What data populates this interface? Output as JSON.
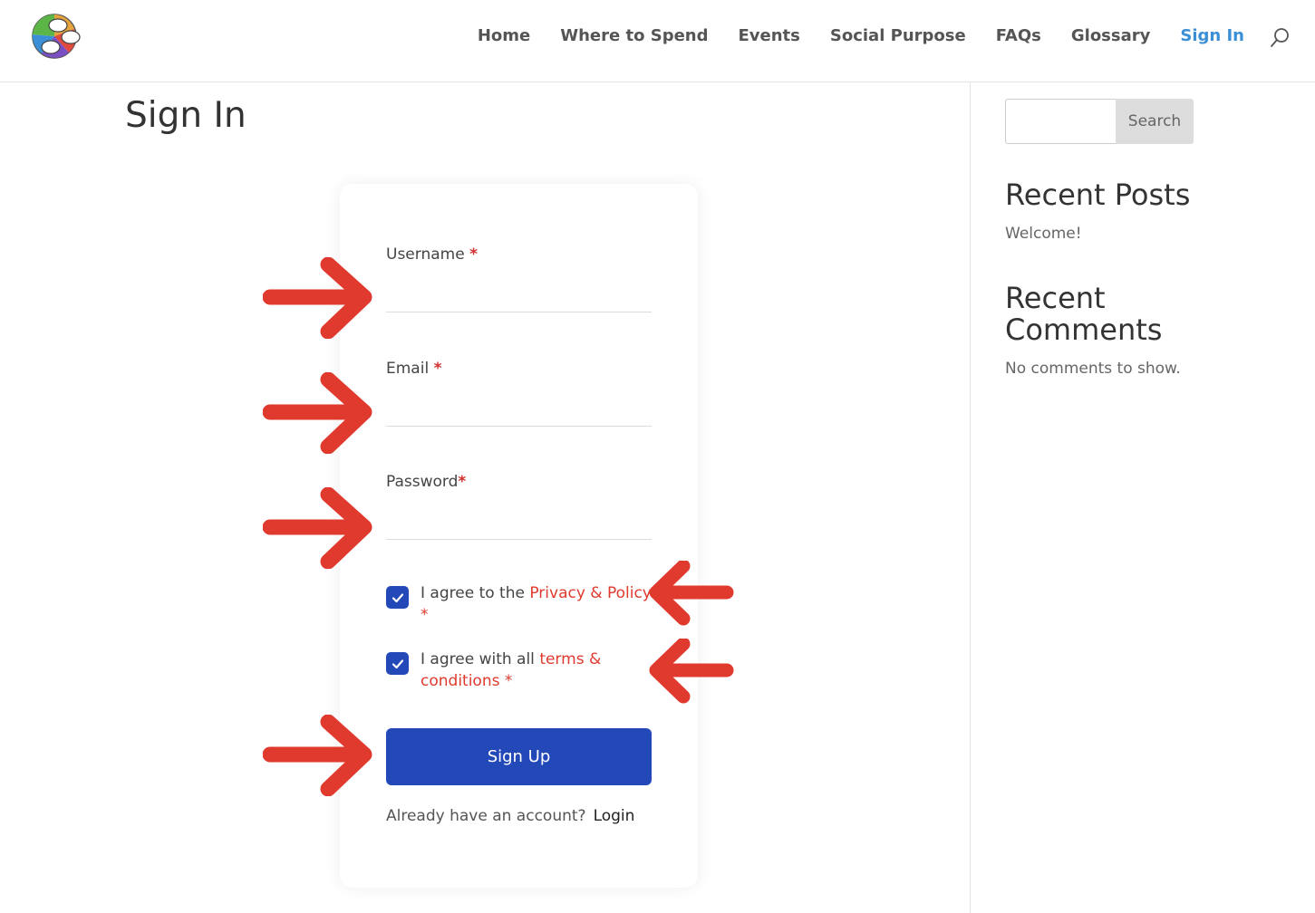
{
  "header": {
    "logo": "site-logo",
    "nav": [
      {
        "label": "Home"
      },
      {
        "label": "Where to Spend"
      },
      {
        "label": "Events"
      },
      {
        "label": "Social Purpose"
      },
      {
        "label": "FAQs"
      },
      {
        "label": "Glossary"
      },
      {
        "label": "Sign In",
        "active": true
      }
    ],
    "search_icon": "search-icon"
  },
  "page": {
    "title": "Sign In"
  },
  "form": {
    "username_label": "Username",
    "email_label": "Email",
    "password_label": "Password",
    "required_mark": "*",
    "privacy": {
      "prefix": "I agree to the ",
      "link": "Privacy & Policy",
      "suffix": "*",
      "checked": true
    },
    "terms": {
      "prefix": "I agree with all ",
      "link": "terms & conditions",
      "suffix": " *",
      "checked": true
    },
    "submit_label": "Sign Up",
    "login_prompt": "Already have an account?",
    "login_link": "Login"
  },
  "sidebar": {
    "search_button": "Search",
    "recent_posts_title": "Recent Posts",
    "recent_posts": [
      "Welcome!"
    ],
    "recent_comments_title": "Recent Comments",
    "recent_comments_empty": "No comments to show."
  },
  "colors": {
    "accent": "#2349b9",
    "active_nav": "#3a8fd6",
    "required": "#d32f2f",
    "annotation_arrow": "#e03a2e"
  }
}
